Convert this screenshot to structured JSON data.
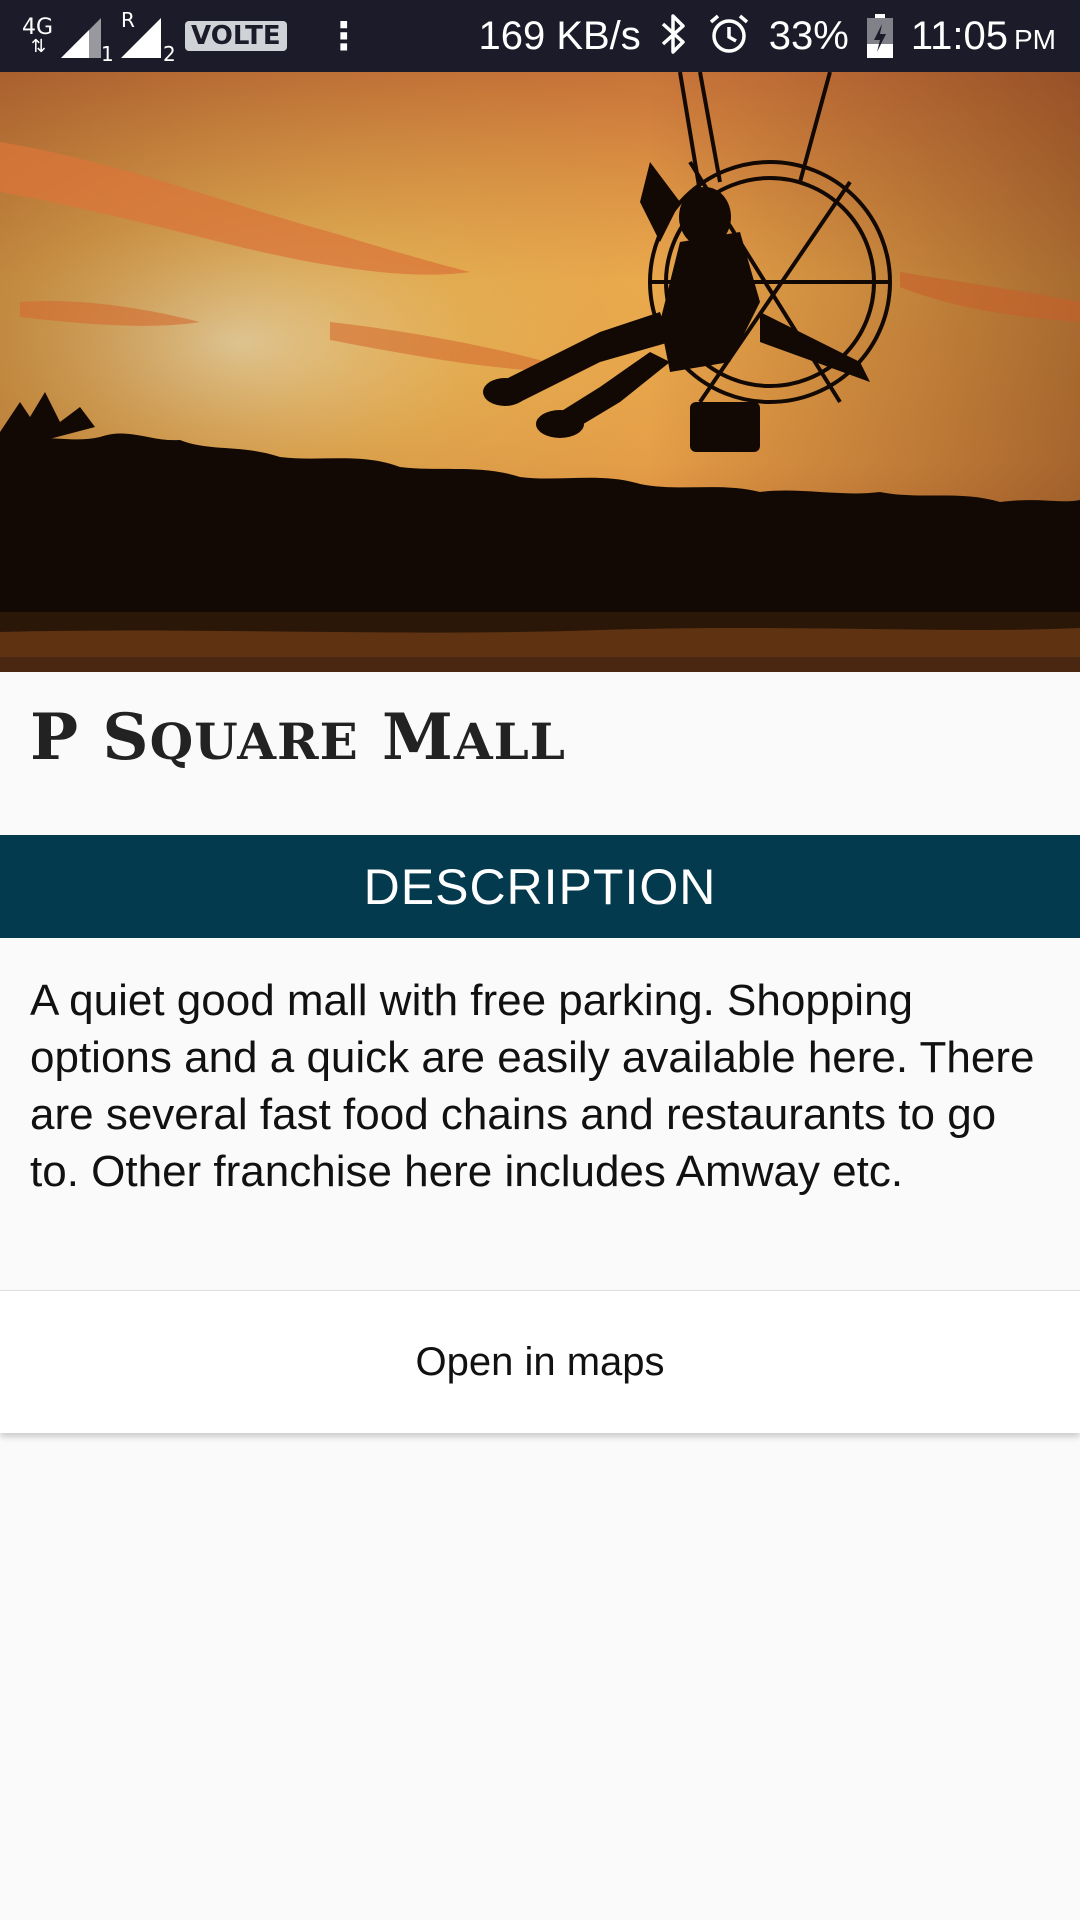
{
  "status_bar": {
    "network_type": "4G",
    "sim1_label": "1",
    "sim2_roaming": "R",
    "sim2_label": "2",
    "volte": "VOLTE",
    "more": "⋮",
    "speed": "169 KB/s",
    "battery": "33%",
    "time": "11:05",
    "time_suffix": "PM",
    "icons": [
      "signal-icon",
      "bluetooth-icon",
      "alarm-icon",
      "battery-icon"
    ]
  },
  "hero": {
    "image": "paramotor-sunset-photo"
  },
  "place": {
    "title_first": "P",
    "title_S": "S",
    "title_quare": "QUARE",
    "title_M": "M",
    "title_all": "ALL"
  },
  "section": {
    "header": "DESCRIPTION"
  },
  "description": {
    "text": "A quiet good mall with free parking. Shopping options and a quick are easily available here. There are several fast food chains and restaurants to go to. Other franchise here includes Amway etc."
  },
  "actions": {
    "open_maps": "Open in maps"
  },
  "colors": {
    "status_bar_bg": "#1b1b29",
    "section_header_bg": "#043a4e",
    "page_bg": "#fafafa"
  }
}
